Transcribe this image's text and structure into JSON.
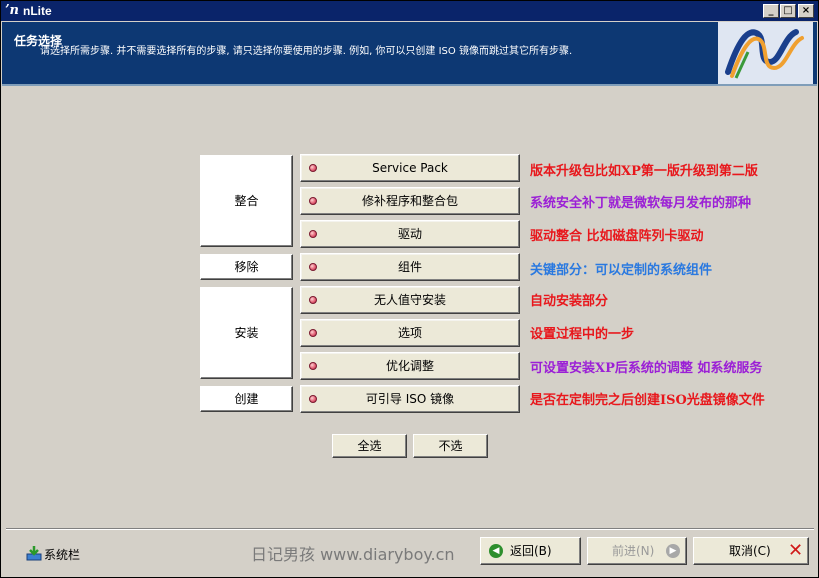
{
  "window": {
    "title": "nLite",
    "minimize": "_",
    "maximize": "□",
    "close": "×"
  },
  "header": {
    "title": "任务选择",
    "description": "请选择所需步骤. 并不需要选择所有的步骤, 请只选择你要使用的步骤. 例如, 你可以只创建 ISO 镜像而跳过其它所有步骤."
  },
  "groups": {
    "integrate": "整合",
    "remove": "移除",
    "setup": "安装",
    "create": "创建"
  },
  "tasks": [
    {
      "label": "Service Pack",
      "note": "版本升级包比如XP第一版升级到第二版",
      "note_color": "#e8171c"
    },
    {
      "label": "修补程序和整合包",
      "note": "系统安全补丁就是微软每月发布的那种",
      "note_color": "#9b1fd6"
    },
    {
      "label": "驱动",
      "note": "驱动整合 比如磁盘阵列卡驱动",
      "note_color": "#e8171c"
    },
    {
      "label": "组件",
      "note": "关键部分：可以定制的系统组件",
      "note_color": "#2a79e0"
    },
    {
      "label": "无人值守安装",
      "note": "自动安装部分",
      "note_color": "#e8171c"
    },
    {
      "label": "选项",
      "note": "设置过程中的一步",
      "note_color": "#e8171c"
    },
    {
      "label": "优化调整",
      "note": "可设置安装XP后系统的调整 如系统服务",
      "note_color": "#9b1fd6"
    },
    {
      "label": "可引导 ISO 镜像",
      "note": "是否在定制完之后创建ISO光盘镜像文件",
      "note_color": "#e8171c"
    }
  ],
  "selection": {
    "select_all": "全选",
    "select_none": "不选"
  },
  "footer": {
    "tray_label": "系统栏",
    "watermark": "日记男孩 www.diaryboy.cn",
    "back": "返回(B)",
    "next": "前进(N)",
    "cancel": "取消(C)"
  },
  "colors": {
    "titlebar": "#0a246a",
    "header_bg": "#0d3873",
    "note_red": "#e8171c",
    "note_purple": "#9b1fd6",
    "note_blue": "#2a79e0"
  }
}
